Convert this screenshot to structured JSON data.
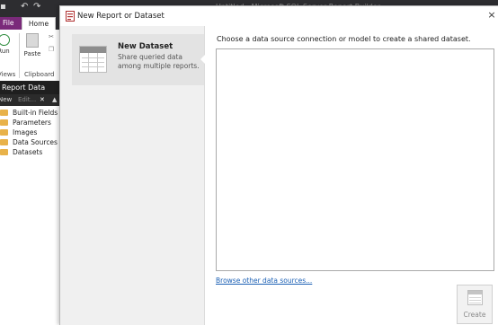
{
  "app": {
    "title": "Untitled - Microsoft SQL Server Report Builder",
    "tabs": [
      "File",
      "Home"
    ],
    "ribbon": {
      "run_label": "Run",
      "paste_label": "Paste",
      "group_views": "Views",
      "group_clipboard": "Clipboard"
    },
    "report_data": {
      "header": "Report Data",
      "toolbar_new": "New",
      "toolbar_edit": "Edit...",
      "items": [
        "Built-in Fields",
        "Parameters",
        "Images",
        "Data Sources",
        "Datasets"
      ]
    }
  },
  "dialog": {
    "title": "New Report or Dataset",
    "close_glyph": "×",
    "options": [
      {
        "title": "New Dataset",
        "description": "Share queried data among multiple reports.",
        "selected": true
      }
    ],
    "instruction": "Choose a data source connection or model to create a shared dataset.",
    "browse_link": "Browse other data sources...",
    "create_button": "Create",
    "create_enabled": false
  },
  "colors": {
    "file_tab": "#7a2a7a",
    "title_bar": "#2d2d30",
    "link": "#1a5fb4",
    "folder": "#e8b24a"
  }
}
